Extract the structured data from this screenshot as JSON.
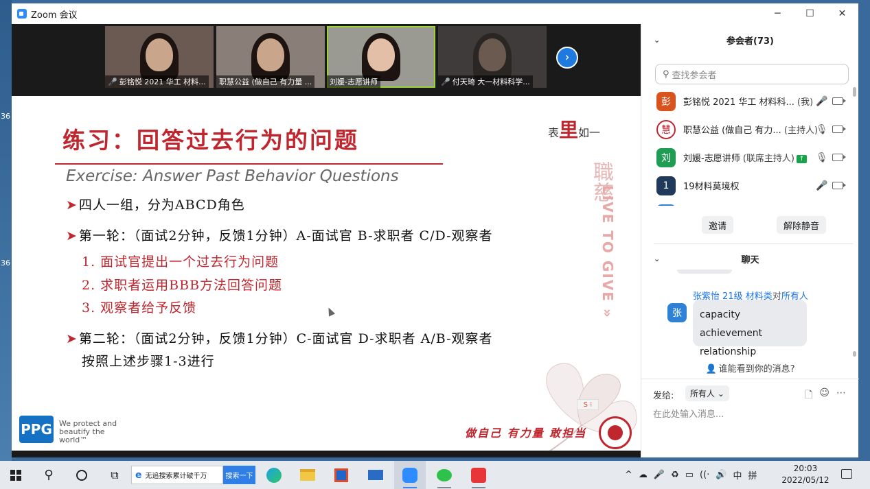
{
  "desktop": {
    "edge_labels": [
      "36",
      "36"
    ]
  },
  "window": {
    "title": "Zoom 会议",
    "controls": [
      "─",
      "☐",
      "✕"
    ]
  },
  "videos": [
    {
      "name": "彭铭悦 2021 华工 材料...",
      "muted": true,
      "active": false
    },
    {
      "name": "职慧公益 (做自己 有力量 ...",
      "muted": false,
      "active": false
    },
    {
      "name": "刘媛-志愿讲师",
      "muted": false,
      "active": true
    },
    {
      "name": "付天琦 大一材料科学...",
      "muted": true,
      "active": false
    }
  ],
  "video_next": "›",
  "slide": {
    "title": "练习：回答过去行为的问题",
    "subtitle": "Exercise: Answer Past Behavior Questions",
    "motto_a": "表",
    "motto_b": "里",
    "motto_c": "如一",
    "vertical_cn": "職慈",
    "vertical_en": "LIVE TO GIVE »",
    "lines": [
      "四人一组，分为ABCD角色",
      "第一轮：（面试2分钟，反馈1分钟）A-面试官 B-求职者 C/D-观察者",
      "1. 面试官提出一个过去行为问题",
      "2. 求职者运用BBB方法回答问题",
      "3. 观察者给予反馈",
      "第二轮：（面试2分钟，反馈1分钟）C-面试官 D-求职者 A/B-观察者",
      "按照上述步骤1-3进行"
    ],
    "arrow": "➤",
    "ppg_logo": "PPG",
    "ppg_tagline": "We protect and beautify the world™",
    "slogan": "做自己 有力量 敢担当",
    "ime_badge": "S ⁝"
  },
  "participants": {
    "header": "参会者(73)",
    "search_placeholder": "查找参会者",
    "list": [
      {
        "avatar_text": "彭",
        "avatar_color": "#d9531e",
        "name": "彭铭悦 2021 华工 材料科...",
        "tag": "(我)",
        "mic": "muted"
      },
      {
        "avatar_text": "慧",
        "avatar_color": "#c0262e",
        "name": "职慧公益 (做自己 有力...",
        "tag": "(主持人)",
        "mic": "on"
      },
      {
        "avatar_text": "刘",
        "avatar_color": "#1f9d55",
        "name": "刘媛-志愿讲师",
        "tag": "(联席主持人)",
        "mic": "on",
        "sharing": true
      },
      {
        "avatar_text": "1",
        "avatar_color": "#1f3a5a",
        "name": "19材料莫境权",
        "tag": "",
        "mic": "muted"
      }
    ],
    "invite_button": "邀请",
    "unmute_button": "解除静音"
  },
  "chat": {
    "header": "聊天",
    "sender": "张紫怡 21级 材料类",
    "to_word": "对",
    "recipient": "所有人",
    "avatar_text": "张",
    "avatar_color": "#2e82d6",
    "message": "capacity achievement relationship",
    "who_can_see": "谁能看到你的消息?",
    "send_to_label": "发给:",
    "send_to_value": "所有人",
    "input_placeholder": "在此处输入消息..."
  },
  "taskbar": {
    "search_text": "无追搜索累计破千万",
    "search_button": "搜索一下",
    "tray": [
      "^",
      "☁",
      "🎤",
      "♻",
      "▭",
      "((·",
      "🔊",
      "中",
      "拼"
    ],
    "time": "20:03",
    "date": "2022/05/12"
  }
}
